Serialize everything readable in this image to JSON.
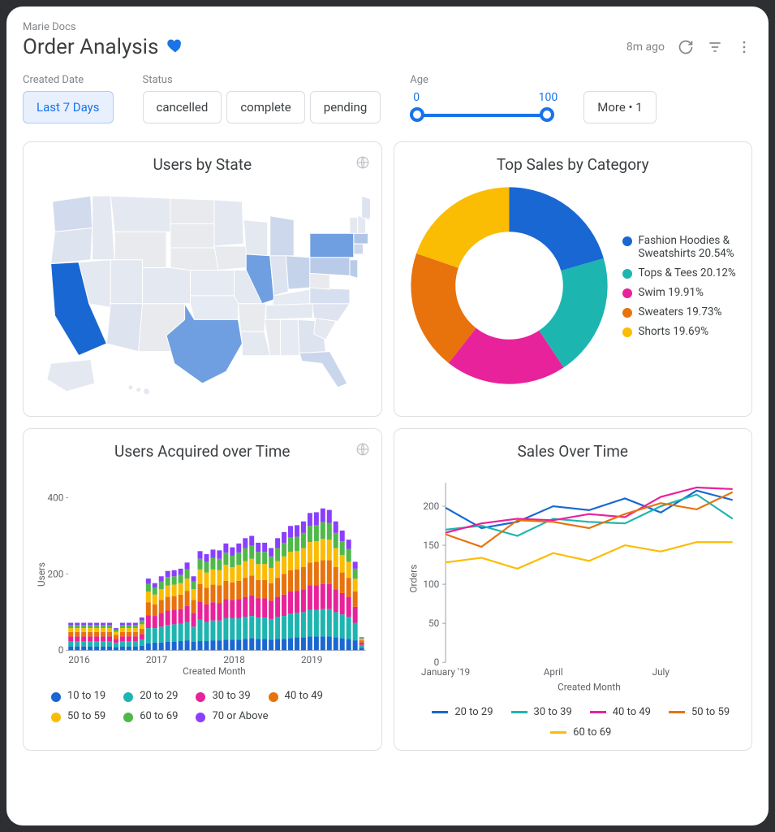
{
  "breadcrumb": "Marie Docs",
  "title": "Order Analysis",
  "header": {
    "timestamp": "8m ago"
  },
  "filters": {
    "created_date": {
      "label": "Created Date",
      "options": [
        "Last 7 Days"
      ],
      "selected": "Last 7 Days"
    },
    "status": {
      "label": "Status",
      "options": [
        "cancelled",
        "complete",
        "pending"
      ]
    },
    "age": {
      "label": "Age",
      "min": 0,
      "max": 100
    },
    "more": {
      "label": "More • 1"
    }
  },
  "cards": {
    "users_by_state": {
      "title": "Users by State"
    },
    "top_sales": {
      "title": "Top Sales by Category"
    },
    "users_acquired": {
      "title": "Users Acquired over Time",
      "xlabel": "Created Month",
      "ylabel": "Users"
    },
    "sales_over_time": {
      "title": "Sales Over Time",
      "xlabel": "Created Month",
      "ylabel": "Orders"
    }
  },
  "chart_data": [
    {
      "id": "users_by_state",
      "type": "map",
      "region": "US",
      "highlights": [
        {
          "state": "CA",
          "intensity": 1.0
        },
        {
          "state": "TX",
          "intensity": 0.6
        },
        {
          "state": "NY",
          "intensity": 0.6
        },
        {
          "state": "IL",
          "intensity": 0.6
        },
        {
          "state": "PA",
          "intensity": 0.45
        },
        {
          "state": "FL",
          "intensity": 0.35
        },
        {
          "state": "OH",
          "intensity": 0.35
        }
      ],
      "scale": [
        "#e8eaed",
        "#1967d2"
      ]
    },
    {
      "id": "top_sales",
      "type": "pie",
      "donut": true,
      "title": "Top Sales by Category",
      "series": [
        {
          "name": "Fashion Hoodies & Sweatshirts",
          "value": 20.54,
          "color": "#1967d2"
        },
        {
          "name": "Tops & Tees",
          "value": 20.12,
          "color": "#1db5b0"
        },
        {
          "name": "Swim",
          "value": 19.91,
          "color": "#e8229b"
        },
        {
          "name": "Sweaters",
          "value": 19.73,
          "color": "#e8720c"
        },
        {
          "name": "Shorts",
          "value": 19.69,
          "color": "#fbbc04"
        }
      ]
    },
    {
      "id": "users_acquired",
      "type": "bar",
      "stacked": true,
      "title": "Users Acquired over Time",
      "xlabel": "Created Month",
      "ylabel": "Users",
      "ylim": [
        0,
        450
      ],
      "yticks": [
        0,
        200,
        400
      ],
      "xticks": [
        "2016",
        "2017",
        "2018",
        "2019"
      ],
      "categories": [
        "2016-01",
        "2016-02",
        "2016-03",
        "2016-04",
        "2016-05",
        "2016-06",
        "2016-07",
        "2016-08",
        "2016-09",
        "2016-10",
        "2016-11",
        "2016-12",
        "2017-01",
        "2017-02",
        "2017-03",
        "2017-04",
        "2017-05",
        "2017-06",
        "2017-07",
        "2017-08",
        "2017-09",
        "2017-10",
        "2017-11",
        "2017-12",
        "2018-01",
        "2018-02",
        "2018-03",
        "2018-04",
        "2018-05",
        "2018-06",
        "2018-07",
        "2018-08",
        "2018-09",
        "2018-10",
        "2018-11",
        "2018-12",
        "2019-01",
        "2019-02",
        "2019-03",
        "2019-04",
        "2019-05",
        "2019-06",
        "2019-07",
        "2019-08",
        "2019-09",
        "2019-10"
      ],
      "series": [
        {
          "name": "10 to 19",
          "color": "#1967d2",
          "values": [
            10,
            10,
            10,
            10,
            10,
            10,
            10,
            8,
            10,
            10,
            10,
            12,
            18,
            20,
            20,
            22,
            22,
            24,
            26,
            22,
            24,
            24,
            26,
            26,
            28,
            28,
            28,
            30,
            32,
            30,
            30,
            28,
            30,
            30,
            32,
            34,
            34,
            36,
            36,
            36,
            36,
            34,
            32,
            30,
            26,
            6
          ]
        },
        {
          "name": "20 to 29",
          "color": "#1db5b0",
          "values": [
            14,
            14,
            14,
            14,
            14,
            14,
            14,
            12,
            14,
            14,
            14,
            16,
            40,
            38,
            42,
            44,
            46,
            46,
            48,
            40,
            56,
            50,
            52,
            52,
            56,
            56,
            56,
            58,
            58,
            56,
            56,
            54,
            58,
            60,
            64,
            64,
            66,
            70,
            70,
            72,
            72,
            66,
            62,
            58,
            46,
            8
          ]
        },
        {
          "name": "30 to 39",
          "color": "#e8229b",
          "values": [
            12,
            12,
            12,
            12,
            12,
            12,
            12,
            10,
            12,
            12,
            12,
            14,
            34,
            32,
            36,
            38,
            38,
            38,
            42,
            36,
            48,
            46,
            48,
            46,
            50,
            48,
            50,
            52,
            54,
            50,
            50,
            48,
            52,
            56,
            58,
            58,
            60,
            64,
            64,
            66,
            66,
            60,
            56,
            52,
            42,
            6
          ]
        },
        {
          "name": "40 to 49",
          "color": "#e8720c",
          "values": [
            12,
            12,
            12,
            12,
            12,
            12,
            12,
            10,
            12,
            12,
            12,
            14,
            34,
            30,
            34,
            36,
            36,
            38,
            40,
            34,
            46,
            44,
            46,
            46,
            48,
            46,
            48,
            50,
            52,
            48,
            48,
            46,
            50,
            54,
            56,
            56,
            58,
            60,
            62,
            62,
            62,
            58,
            54,
            50,
            40,
            6
          ]
        },
        {
          "name": "50 to 59",
          "color": "#fbbc04",
          "values": [
            10,
            10,
            10,
            10,
            10,
            10,
            10,
            8,
            10,
            10,
            10,
            12,
            28,
            26,
            28,
            30,
            30,
            30,
            32,
            28,
            38,
            40,
            40,
            40,
            42,
            40,
            42,
            44,
            44,
            42,
            42,
            40,
            44,
            46,
            48,
            48,
            50,
            54,
            54,
            56,
            54,
            50,
            46,
            42,
            34,
            4
          ]
        },
        {
          "name": "60 to 69",
          "color": "#50b84a",
          "values": [
            8,
            8,
            8,
            8,
            8,
            8,
            8,
            6,
            8,
            8,
            8,
            10,
            20,
            18,
            20,
            22,
            22,
            22,
            24,
            20,
            28,
            28,
            30,
            30,
            32,
            30,
            32,
            34,
            34,
            32,
            32,
            30,
            34,
            36,
            38,
            38,
            40,
            42,
            42,
            44,
            44,
            40,
            36,
            34,
            26,
            2
          ]
        },
        {
          "name": "70 or Above",
          "color": "#8a3ffc",
          "values": [
            6,
            6,
            6,
            6,
            6,
            6,
            6,
            4,
            6,
            6,
            6,
            8,
            14,
            12,
            14,
            16,
            16,
            16,
            18,
            14,
            20,
            20,
            22,
            22,
            24,
            22,
            24,
            26,
            26,
            24,
            24,
            22,
            26,
            28,
            30,
            30,
            30,
            34,
            34,
            36,
            34,
            30,
            28,
            24,
            18,
            2
          ]
        }
      ]
    },
    {
      "id": "sales_over_time",
      "type": "line",
      "title": "Sales Over Time",
      "xlabel": "Created Month",
      "ylabel": "Orders",
      "ylim": [
        0,
        230
      ],
      "yticks": [
        0,
        50,
        100,
        150,
        200
      ],
      "categories": [
        "January '19",
        "February",
        "March",
        "April",
        "May",
        "June",
        "July",
        "August",
        "September"
      ],
      "xticks": [
        "January '19",
        "April",
        "July"
      ],
      "series": [
        {
          "name": "20 to 29",
          "color": "#1967d2",
          "values": [
            198,
            172,
            180,
            200,
            195,
            210,
            192,
            220,
            208
          ]
        },
        {
          "name": "30 to 39",
          "color": "#1db5b0",
          "values": [
            170,
            175,
            162,
            184,
            180,
            178,
            200,
            215,
            184
          ]
        },
        {
          "name": "40 to 49",
          "color": "#e8229b",
          "values": [
            166,
            178,
            184,
            182,
            190,
            186,
            212,
            224,
            222
          ]
        },
        {
          "name": "50 to 59",
          "color": "#e8720c",
          "values": [
            164,
            148,
            182,
            180,
            172,
            190,
            204,
            196,
            218
          ]
        },
        {
          "name": "60 to 69",
          "color": "#fbbc04",
          "values": [
            128,
            134,
            120,
            140,
            130,
            150,
            142,
            154,
            154
          ]
        }
      ]
    }
  ]
}
